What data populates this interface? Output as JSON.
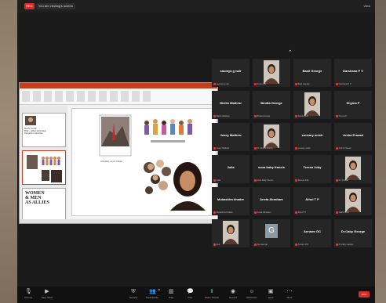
{
  "topbar": {
    "rec_label": "REC",
    "share_label": "You are viewing's screen",
    "view_label": "View"
  },
  "ppt": {
    "thumb_text": [
      "Suzzle Sunita",
      "Pillai – skilled technology",
      "Panigrahi to Aberlase"
    ],
    "women_text": [
      "WOMEN",
      "& MEN",
      "AS ALLIES"
    ],
    "slide_caption": "Life offers us our Choice"
  },
  "participants": [
    {
      "name": "saumya g nair",
      "label": "saumya g nair",
      "kind": "name"
    },
    {
      "name": "",
      "label": "Sowmy IV",
      "kind": "photo"
    },
    {
      "name": "Basil George",
      "label": "Basil George",
      "kind": "name"
    },
    {
      "name": "Darshana P V",
      "label": "Darshana P V",
      "kind": "name"
    },
    {
      "name": "Merlin Mathew",
      "label": "Merlin Mathew",
      "kind": "name"
    },
    {
      "name": "Binitta George",
      "label": "Binitta George",
      "kind": "name"
    },
    {
      "name": "",
      "label": "Sonali Dent",
      "kind": "photo"
    },
    {
      "name": "Shyma P",
      "label": "Shyma P",
      "kind": "name"
    },
    {
      "name": "Josey Mathew",
      "label": "Josey Mathew",
      "kind": "name"
    },
    {
      "name": "",
      "label": "Dr. Resmi Antony",
      "kind": "photo"
    },
    {
      "name": "sunsary anish",
      "label": "sunsary anish",
      "kind": "name"
    },
    {
      "name": "Arsha Prasad",
      "label": "Arsha Prasad",
      "kind": "name"
    },
    {
      "name": "Julia",
      "label": "Julia",
      "kind": "name"
    },
    {
      "name": "sona baby francis",
      "label": "sona baby francis",
      "kind": "name"
    },
    {
      "name": "Teresa Joby",
      "label": "Teresa Joby",
      "kind": "name"
    },
    {
      "name": "",
      "label": "Dr. Prasad",
      "kind": "photo"
    },
    {
      "name": "Mubashira khader",
      "label": "Mubashira Khader",
      "kind": "name"
    },
    {
      "name": "Aneta Abraham",
      "label": "Aneta Abraham",
      "kind": "name"
    },
    {
      "name": "Athul T P",
      "label": "Athul T P",
      "kind": "name"
    },
    {
      "name": "",
      "label": "Sakhi Sunil",
      "kind": "photo"
    },
    {
      "name": "",
      "label": "Reji",
      "kind": "photo"
    },
    {
      "name": "G",
      "label": "Jiju George",
      "kind": "initial"
    },
    {
      "name": "Annsmr DC",
      "label": "Annsmr DC",
      "kind": "name"
    },
    {
      "name": "Dr.Caby George",
      "label": "Dr.Caby George",
      "kind": "name"
    }
  ],
  "toolbar": {
    "unmute": "Unmute",
    "stop_video": "Stop Video",
    "security": "Security",
    "participants": "Participants",
    "participants_count": "32",
    "polls": "Polls",
    "chat": "Chat",
    "share_screen": "Share Screen",
    "record": "Record",
    "reactions": "Reactions",
    "apps": "Apps",
    "more": "More",
    "end": "End"
  },
  "colors": {
    "zoom_bg": "#1a1a1a",
    "tile_bg": "#262626",
    "ppt_accent": "#c43e1c",
    "mic_muted": "#e23535",
    "share_green": "#23b34a",
    "end_red": "#d92d2d"
  }
}
